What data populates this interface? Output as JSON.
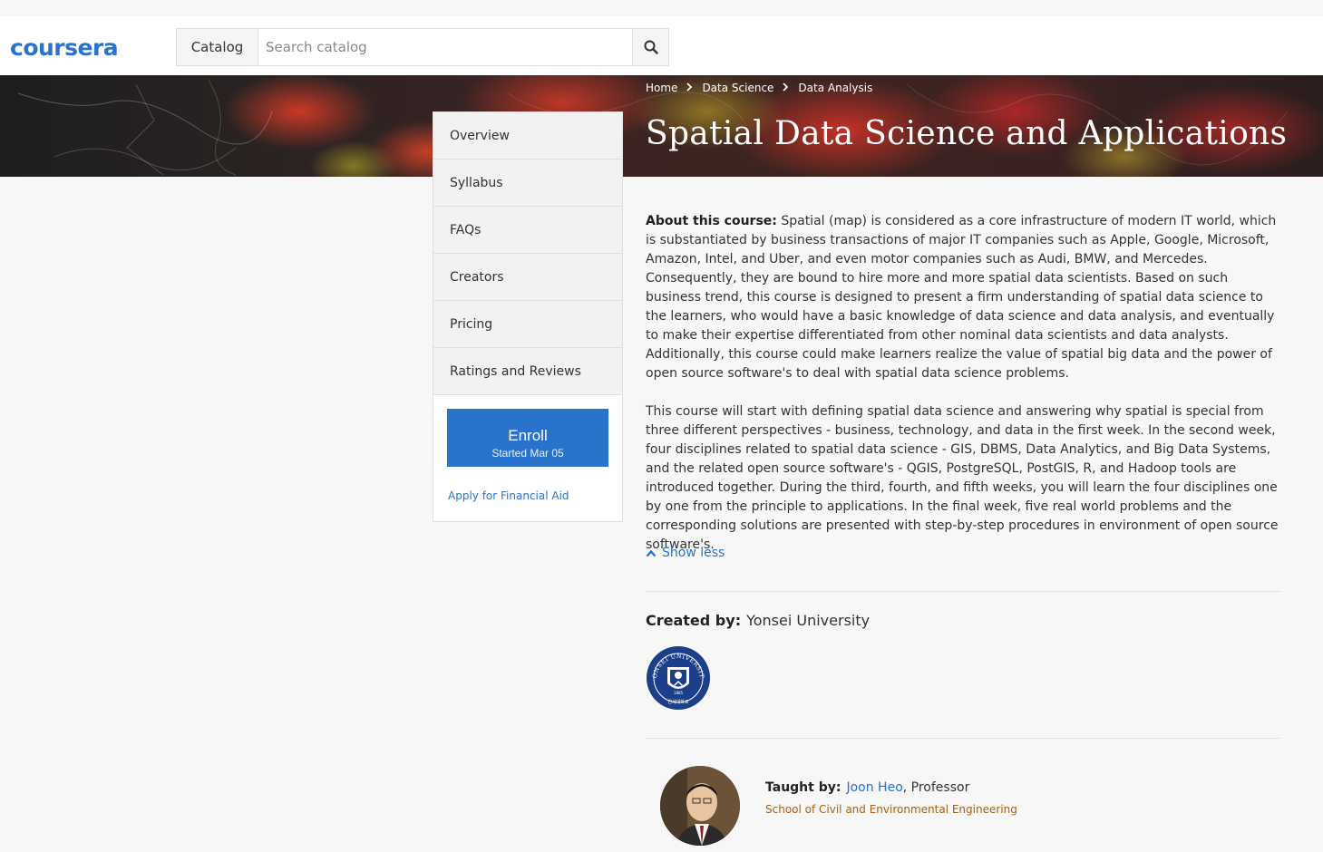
{
  "header": {
    "logo": "coursera",
    "catalog_label": "Catalog",
    "search_placeholder": "Search catalog"
  },
  "breadcrumb": [
    "Home",
    "Data Science",
    "Data Analysis"
  ],
  "course": {
    "title": "Spatial Data Science and Applications"
  },
  "sidenav": {
    "items": [
      "Overview",
      "Syllabus",
      "FAQs",
      "Creators",
      "Pricing",
      "Ratings and Reviews"
    ],
    "enroll_label": "Enroll",
    "enroll_sub": "Started Mar 05",
    "financial_aid": "Apply for Financial Aid"
  },
  "about": {
    "heading": "About this course:",
    "p1": "Spatial (map) is considered as a core infrastructure of modern IT world, which is substantiated by business transactions of major IT companies such as Apple, Google, Microsoft, Amazon, Intel, and Uber, and even motor companies such as Audi, BMW, and Mercedes. Consequently, they are bound to hire more and more spatial data scientists.  Based on such business trend, this course is designed to present a firm understanding of spatial data science to the learners, who would have a basic knowledge of data science and data analysis, and eventually to make their expertise differentiated from other nominal data scientists and data analysts.  Additionally, this course could make learners realize the value of spatial big data and the power of open source software's to deal with spatial data science problems.",
    "p2": "This course will start with defining spatial data science and answering why spatial is special from three different perspectives - business, technology, and data in the first week.  In the second week, four disciplines related to spatial data science - GIS, DBMS, Data Analytics, and Big Data Systems, and the related open source software's - QGIS, PostgreSQL, PostGIS, R, and Hadoop tools are introduced together.  During the third, fourth, and fifth weeks, you will learn the four disciplines one by one from the principle to applications.  In the final week, five real world problems and the corresponding solutions are presented with step-by-step procedures in environment of open source software's.",
    "show_less": "Show less"
  },
  "creator": {
    "label": "Created by:",
    "name": "Yonsei University",
    "seal_text": "YONSEI UNIVERSITY",
    "seal_year": "1885",
    "seal_korean": "연세대학교"
  },
  "instructor": {
    "label": "Taught by:",
    "name": "Joon Heo",
    "title": ", Professor",
    "department": "School of Civil and Environmental Engineering"
  },
  "colors": {
    "accent": "#2a73cc",
    "dept": "#a0621a",
    "seal": "#1c3f8a"
  }
}
